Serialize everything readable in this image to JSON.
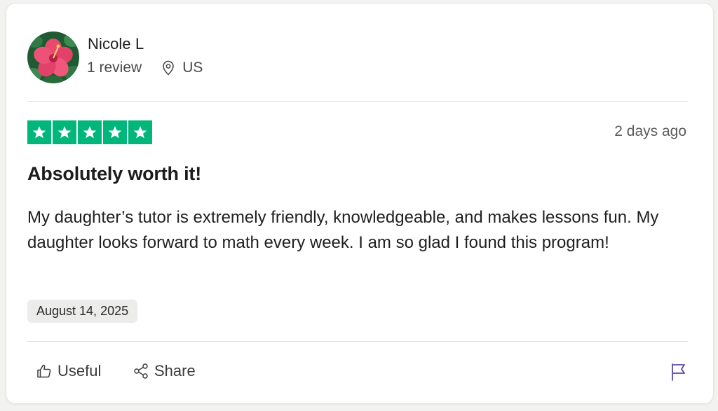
{
  "reviewer": {
    "name": "Nicole L",
    "review_count": "1 review",
    "country": "US"
  },
  "review": {
    "rating": 5,
    "rating_max": 5,
    "posted_ago": "2 days ago",
    "title": "Absolutely worth it!",
    "body": "My daughter’s tutor is extremely friendly, knowledgeable, and makes lessons fun. My daughter looks forward to math every week. I am so glad I found this program!",
    "experience_date": "August 14, 2025"
  },
  "actions": {
    "useful_label": "Useful",
    "share_label": "Share"
  },
  "icons": {
    "avatar": "hibiscus-flower",
    "location": "map-pin-icon",
    "star": "star-icon",
    "useful": "thumbs-up-icon",
    "share": "share-icon",
    "report": "flag-icon"
  },
  "colors": {
    "star_green": "#00b67a",
    "flag_purple": "#5b4ba8"
  }
}
